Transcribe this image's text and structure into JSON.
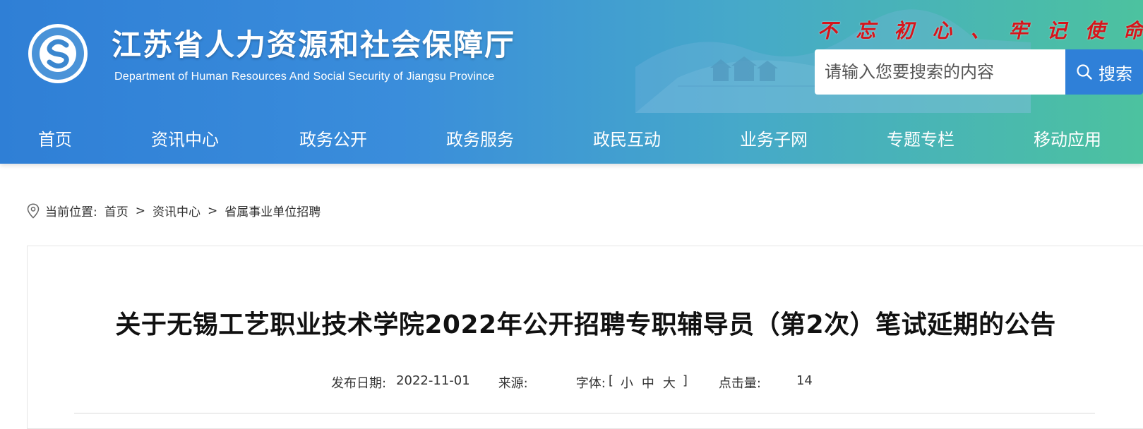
{
  "header": {
    "title": "江苏省人力资源和社会保障厅",
    "subtitle": "Department of Human Resources And Social Security of Jiangsu Province",
    "slogan_left": [
      "不",
      "忘",
      "初",
      "心"
    ],
    "slogan_sep": "、",
    "slogan_right": [
      "牢",
      "记",
      "使",
      "命"
    ],
    "slogan_color": "#d6151b",
    "logo_icon": "department-seal-logo"
  },
  "search": {
    "placeholder": "请输入您要搜索的内容",
    "value": "",
    "button_label": "搜索",
    "button_icon": "search-icon",
    "button_color": "#2f80d8"
  },
  "nav": {
    "items": [
      "首页",
      "资讯中心",
      "政务公开",
      "政务服务",
      "政民互动",
      "业务子网",
      "专题专栏",
      "移动应用"
    ]
  },
  "breadcrumb": {
    "icon": "location-pin-icon",
    "prefix": "当前位置:",
    "items": [
      "首页",
      "资讯中心",
      "省属事业单位招聘"
    ],
    "separator": ">"
  },
  "article": {
    "title": "关于无锡工艺职业技术学院2022年公开招聘专职辅导员（第2次）笔试延期的公告",
    "publish_label": "发布日期:",
    "publish_date": "2022-11-01",
    "source_label": "来源:",
    "source_value": "",
    "font_label": "字体:",
    "font_open": "[",
    "font_sizes": [
      "小",
      "中",
      "大"
    ],
    "font_close": "]",
    "clicks_label": "点击量:",
    "clicks_value": "14"
  }
}
